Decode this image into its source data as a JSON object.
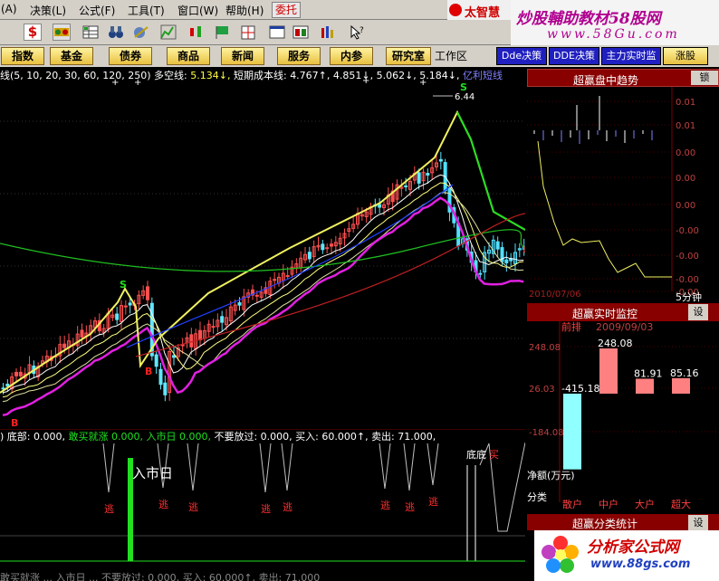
{
  "menu": [
    "(A)",
    "决策(L)",
    "公式(F)",
    "工具(T)",
    "窗口(W)",
    "帮助(H)"
  ],
  "weituo_label": "委托",
  "brand_label": "太智慧",
  "watermark_top": {
    "title": "炒股輔助教材58股网",
    "url": "www.58Gu.com"
  },
  "nav_buttons": [
    "指数",
    "基金",
    "债券",
    "商品",
    "新闻",
    "服务",
    "内参",
    "研究室"
  ],
  "workarea_label": "工作区",
  "tabs": [
    "Dde决策",
    "DDE决策",
    "主力实时监",
    "涨股"
  ],
  "ma_legend": {
    "ma_periods": "线(5, 10, 20, 30, 60, 120, 250)",
    "duokong_label": "多空线:",
    "duokong_value": "5.134↓,",
    "short_cost_label": "短期成本线:",
    "short_cost_values": "4.767↑,  4.851↓,  5.062↓,  5.184↓,",
    "extra": "亿利短线"
  },
  "peak_price": "6.44",
  "indicator_legend": {
    "dibu": ") 底部: 0.000,",
    "gankuai": "敢买就涨  0.000,",
    "rushi": "入市日  0.000,",
    "buyao": "不要放过: 0.000,",
    "mairu": "买入: 60.000↑,",
    "maichu": "卖出: 71.000,"
  },
  "indicator_legend_bottom": "敢买就涨 ...  入市日 ...  不要放过: 0.000, 买入: 60.000↑, 卖出: 71.000",
  "rushi_big": "入市日",
  "tao_label": "逃",
  "didi_label": "底底",
  "mai_label": "买",
  "signal_s": "S",
  "signal_b": "B",
  "panel1": {
    "title": "超赢盘中趋势",
    "lock": "锁",
    "yaxis": [
      "0.01",
      "0.01",
      "0.00",
      "0.00",
      "0.00",
      "-0.00",
      "-0.00",
      "-0.00",
      "-0.00"
    ],
    "date": "2010/07/06",
    "period": "5分钟"
  },
  "panel2": {
    "title": "超赢实时监控",
    "settings": "设",
    "red_label": "前排",
    "date": "2009/09/03",
    "yaxis": [
      "248.08",
      "26.03",
      "-184.08"
    ],
    "bars": [
      {
        "category": "散户",
        "value": -415.18,
        "label": "-415.18",
        "color": "#8fffff"
      },
      {
        "category": "中户",
        "value": 248.08,
        "label": "248.08",
        "color": "#ff8080"
      },
      {
        "category": "大户",
        "value": 81.91,
        "label": "81.91",
        "color": "#ff8080"
      },
      {
        "category": "超大",
        "value": 85.16,
        "label": "85.16",
        "color": "#ff8080"
      }
    ],
    "net_label": "净额(万元)",
    "cat_label": "分类"
  },
  "panel3": {
    "title": "超赢分类统计",
    "settings": "设"
  },
  "watermark_bottom": {
    "title": "分析家公式网",
    "url": "www.88gs.com"
  },
  "colors": {
    "up": "#ff5050",
    "down": "#50e0ff",
    "ma_magenta": "#e020e0",
    "ma_green": "#20c020",
    "ma_blue": "#2040ff",
    "ma_red": "#c02020"
  }
}
